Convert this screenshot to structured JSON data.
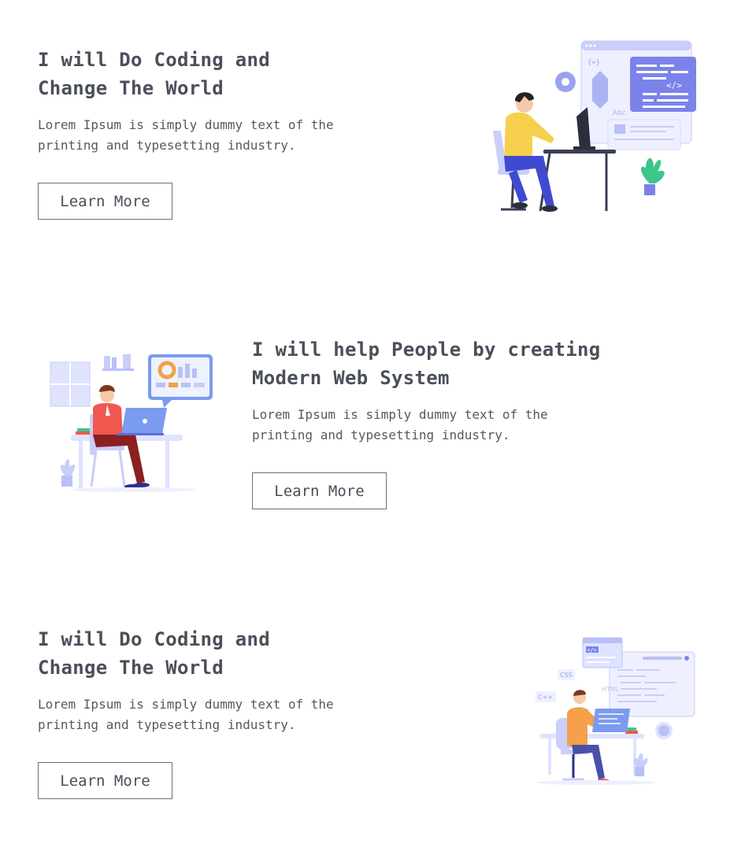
{
  "sections": [
    {
      "title_line1": "I will Do Coding and",
      "title_line2": "Change The World",
      "desc_line1": "Lorem Ipsum is simply dummy text of the",
      "desc_line2": "printing and typesetting industry.",
      "button_label": "Learn More",
      "illustration": "developer-at-desk-with-code-window"
    },
    {
      "title_line1": "I will help People by creating",
      "title_line2": "Modern Web System",
      "desc_line1": "Lorem Ipsum is simply dummy text of the",
      "desc_line2": "printing and typesetting industry.",
      "button_label": "Learn More",
      "illustration": "person-with-laptop-and-dashboard"
    },
    {
      "title_line1": "I will Do Coding and",
      "title_line2": "Change The World",
      "desc_line1": "Lorem Ipsum is simply dummy text of the",
      "desc_line2": "printing and typesetting industry.",
      "button_label": "Learn More",
      "illustration": "developer-with-css-html-code-panels"
    }
  ],
  "illustration_text": {
    "code_tag": "</>",
    "abc": "Abc",
    "css": "CSS",
    "html": "HTML",
    "cpp": "C++"
  },
  "colors": {
    "text": "#4a4f5a",
    "accent_blue": "#7b83eb",
    "light_blue": "#dfe3ff",
    "shirt_yellow": "#f6d04d",
    "shirt_red": "#f0584f",
    "shirt_orange": "#f5a04a",
    "plant_green": "#3cc68a"
  }
}
